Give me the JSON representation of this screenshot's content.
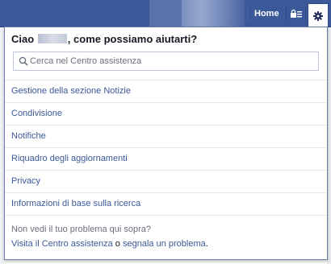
{
  "header": {
    "home_label": "Home",
    "icons": {
      "privacy": "privacy-shortcut-icon",
      "settings": "gear-icon"
    },
    "colors": {
      "bar": "#3b5998",
      "link": "#3b5998"
    }
  },
  "help": {
    "greeting": "Ciao",
    "question": ", come possiamo aiutarti?",
    "search_placeholder": "Cerca nel Centro assistenza",
    "topics": [
      {
        "label": "Gestione della sezione Notizie"
      },
      {
        "label": "Condivisione"
      },
      {
        "label": "Notifiche"
      },
      {
        "label": "Riquadro degli aggiornamenti"
      },
      {
        "label": "Privacy"
      },
      {
        "label": "Informazioni di base sulla ricerca"
      }
    ],
    "footer": {
      "question": "Non vedi il tuo problema qui sopra?",
      "help_center_link": "Visita il Centro assistenza",
      "connector": " o ",
      "report_link": "segnala un problema",
      "end": "."
    }
  }
}
